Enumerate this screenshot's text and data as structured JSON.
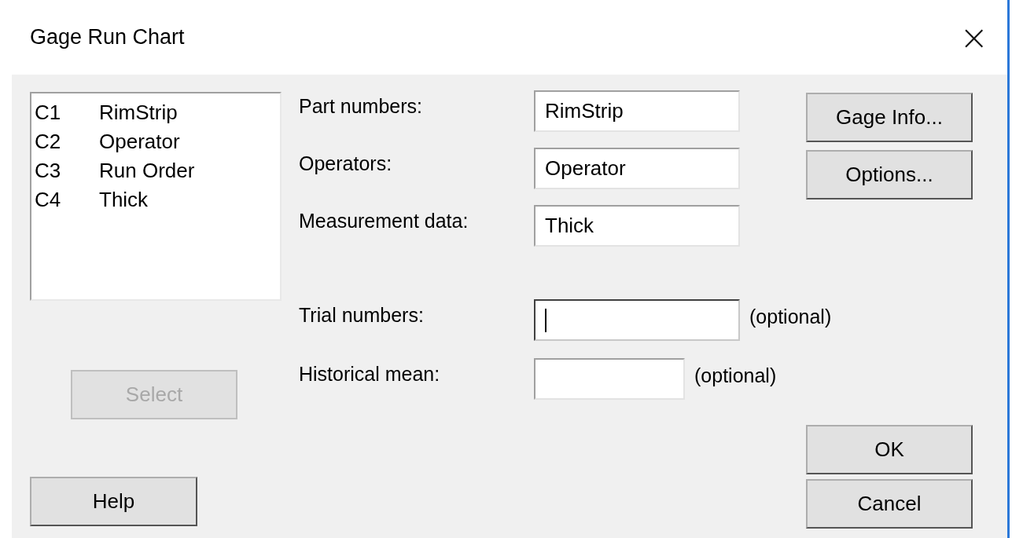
{
  "window": {
    "title": "Gage Run Chart",
    "close": "×"
  },
  "variables": [
    {
      "column": "C1",
      "name": "RimStrip"
    },
    {
      "column": "C2",
      "name": "Operator"
    },
    {
      "column": "C3",
      "name": "Run Order"
    },
    {
      "column": "C4",
      "name": "Thick"
    }
  ],
  "select_button": {
    "label": "Select",
    "disabled": true
  },
  "help_button": {
    "label": "Help"
  },
  "fields": [
    {
      "label": "Part numbers:",
      "value": "RimStrip",
      "focused": false
    },
    {
      "label": "Operators:",
      "value": "Operator",
      "focused": false
    },
    {
      "label": "Measurement data:",
      "value": "Thick",
      "focused": false
    }
  ],
  "optional_fields": [
    {
      "label": "Trial numbers:",
      "focused": true,
      "kind": "wide",
      "note": "(optional)"
    },
    {
      "label": "Historical mean:",
      "focused": false,
      "kind": "narrow",
      "note": "(optional)"
    }
  ],
  "side_buttons": [
    "Gage Info...",
    "Options..."
  ],
  "ok_button": "OK",
  "cancel_button": "Cancel"
}
